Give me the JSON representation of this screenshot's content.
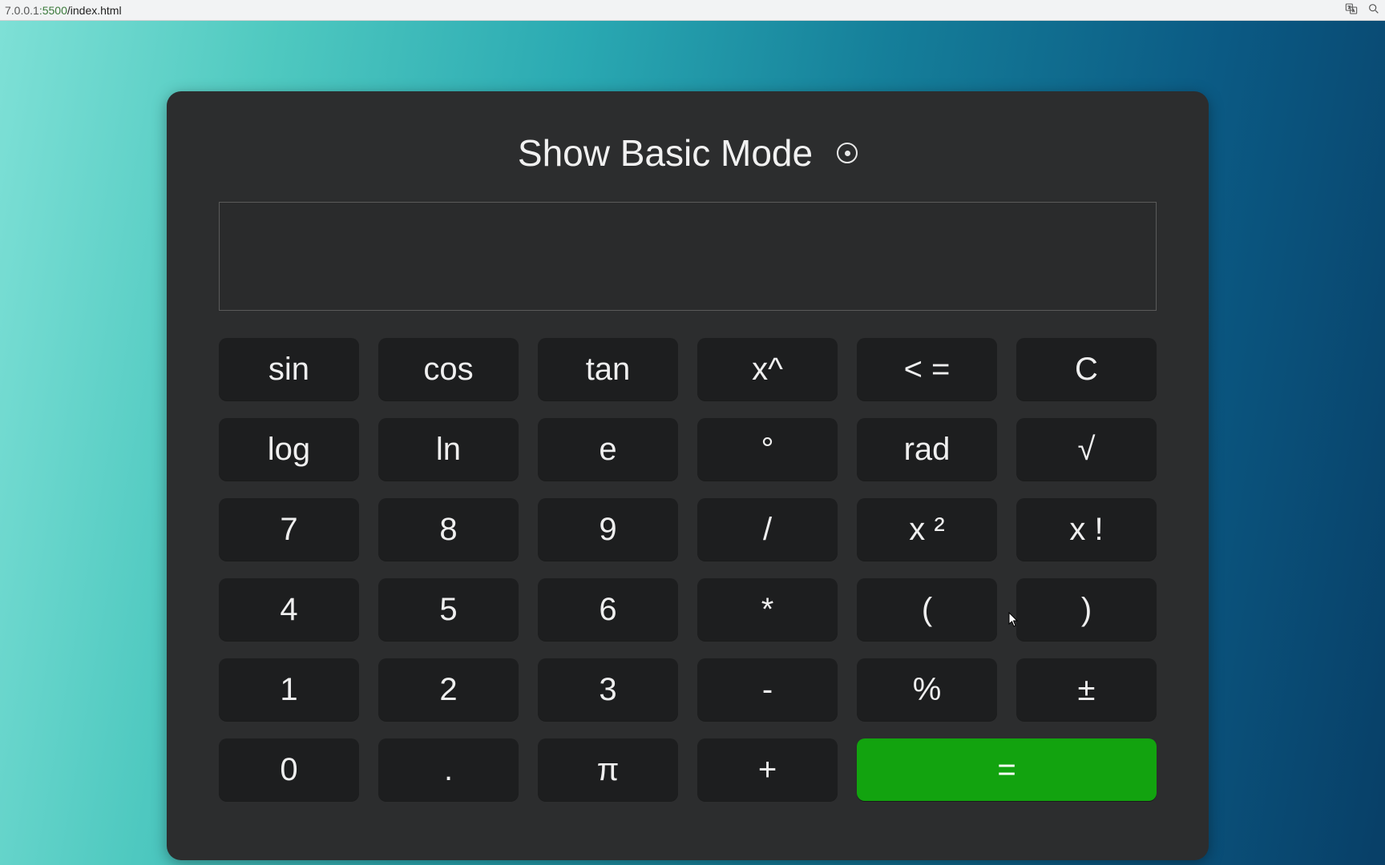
{
  "browser": {
    "url_host": "7.0.0.1",
    "url_port": ":5500",
    "url_path": "/index.html"
  },
  "calculator": {
    "mode_label": "Show Basic Mode",
    "display_value": "",
    "keys": {
      "r0": [
        "sin",
        "cos",
        "tan",
        "x^",
        "< =",
        "C"
      ],
      "r1": [
        "log",
        "ln",
        "e",
        "°",
        "rad",
        "√"
      ],
      "r2": [
        "7",
        "8",
        "9",
        "/",
        "x ²",
        "x !"
      ],
      "r3": [
        "4",
        "5",
        "6",
        "*",
        "(",
        ")"
      ],
      "r4": [
        "1",
        "2",
        "3",
        "-",
        "%",
        "±"
      ],
      "r5": [
        "0",
        ".",
        "π",
        "+",
        "="
      ]
    }
  },
  "colors": {
    "card_bg": "#2c2d2e",
    "key_bg": "#1d1e1f",
    "equals_bg": "#12a30f",
    "gradient_left": "#7ee0d6",
    "gradient_right": "#083f67"
  }
}
